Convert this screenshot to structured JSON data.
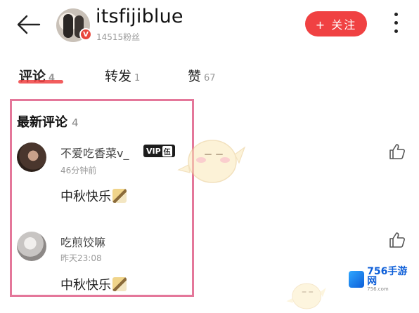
{
  "header": {
    "username": "itsfijiblue",
    "fans": "14515粉丝",
    "verified_mark": "V",
    "follow_label": "+ 关注"
  },
  "tabs": [
    {
      "label": "评论",
      "count": "4",
      "active": true
    },
    {
      "label": "转发",
      "count": "1",
      "active": false
    },
    {
      "label": "赞",
      "count": "67",
      "active": false
    }
  ],
  "section": {
    "title": "最新评论",
    "count": "4"
  },
  "comments": [
    {
      "name": "不爱吃香菜v_",
      "badge": "VIP",
      "badge_level": "伍",
      "time": "46分钟前",
      "text": "中秋快乐"
    },
    {
      "name": "吃煎饺嘛",
      "time": "昨天23:08",
      "text": "中秋快乐"
    }
  ],
  "watermark": {
    "brand": "756手游网",
    "sub": "756.com"
  },
  "colors": {
    "accent": "#f04142",
    "highlight": "#e4779a"
  }
}
